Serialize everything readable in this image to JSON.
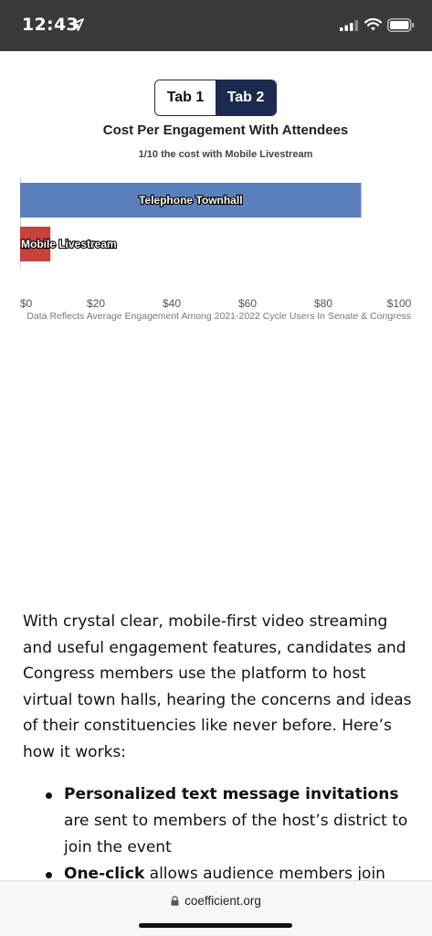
{
  "status_bar": {
    "time": "12:43",
    "icons": [
      "location-arrow-icon",
      "signal-icon",
      "wifi-icon",
      "battery-icon"
    ]
  },
  "tabs": [
    {
      "label": "Tab 1",
      "selected": false
    },
    {
      "label": "Tab 2",
      "selected": true
    }
  ],
  "chart_data": {
    "type": "bar",
    "orientation": "horizontal",
    "title": "Cost Per Engagement With Attendees",
    "subtitle": "1/10 the cost with Mobile Livestream",
    "categories": [
      "Telephone Townhall",
      "Mobile Livestream"
    ],
    "values": [
      90,
      8
    ],
    "colors": [
      "#5b7fbd",
      "#c9413b"
    ],
    "xlim": [
      0,
      100
    ],
    "x_ticks": [
      "$0",
      "$20",
      "$40",
      "$60",
      "$80",
      "$100"
    ],
    "grid": false,
    "note": "Data Reflects Average Engagement Among 2021-2022 Cycle Users In Senate & Congress"
  },
  "article": {
    "paragraph": "With crystal clear, mobile-first video streaming and useful engagement features, candidates and Congress members use the platform to host virtual town halls, hearing the concerns and ideas of their constituencies like never before. Here’s how it works:",
    "bullets": [
      {
        "bold": "Personalized text message invitations",
        "rest": " are sent to members of the host’s district to join the event"
      },
      {
        "bold": "One-click",
        "rest": " allows audience members join"
      }
    ]
  },
  "browser": {
    "url": "coefficient.org"
  },
  "colors": {
    "status_bar_bg": "#3a3a3a",
    "tab_selected_bg": "#1b2a4e"
  }
}
